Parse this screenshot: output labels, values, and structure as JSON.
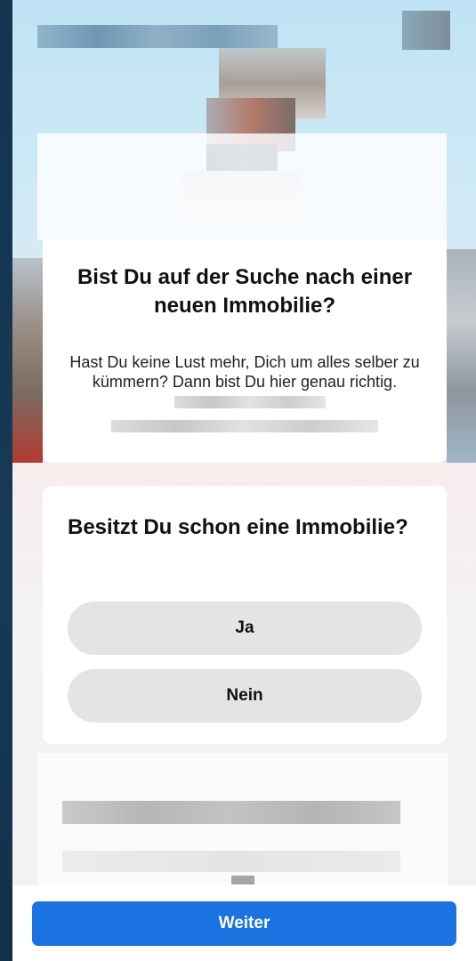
{
  "intro": {
    "title": "Bist Du auf der Suche nach einer neuen Immobilie?",
    "text": "Hast Du keine Lust mehr, Dich um alles selber zu kümmern? Dann bist Du hier genau richtig."
  },
  "question": {
    "title": "Besitzt Du schon eine Immobilie?",
    "options": [
      {
        "label": "Ja"
      },
      {
        "label": "Nein"
      }
    ]
  },
  "footer": {
    "next_label": "Weiter"
  },
  "colors": {
    "accent": "#1a73e0",
    "option_bg": "#e4e4e4",
    "card_bg": "#ffffff"
  }
}
